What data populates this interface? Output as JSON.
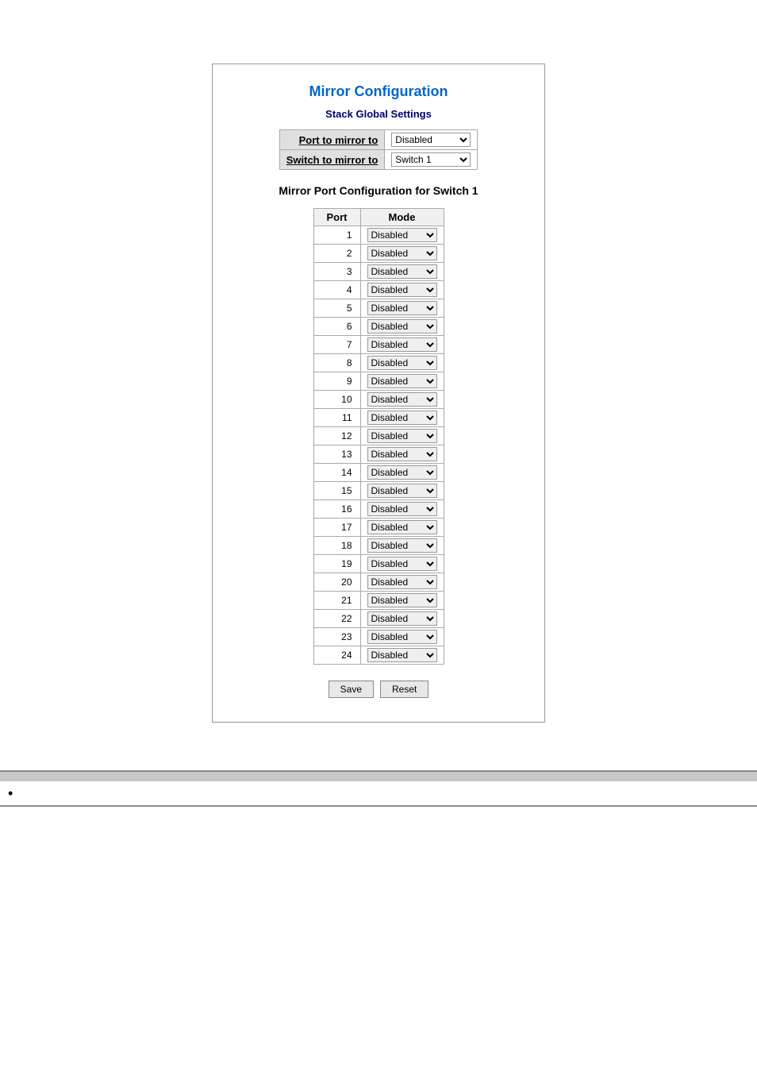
{
  "page": {
    "title": "Mirror Configuration",
    "section_title": "Stack Global Settings",
    "mirror_port_title": "Mirror Port Configuration for Switch 1",
    "global_settings": {
      "port_to_mirror_label": "Port to mirror to",
      "port_to_mirror_value": "Disabled",
      "switch_to_mirror_label": "Switch to mirror to",
      "switch_to_mirror_value": "Switch 1"
    },
    "port_table": {
      "col_port": "Port",
      "col_mode": "Mode",
      "rows": [
        {
          "port": "1",
          "mode": "Disabled"
        },
        {
          "port": "2",
          "mode": "Disabled"
        },
        {
          "port": "3",
          "mode": "Disabled"
        },
        {
          "port": "4",
          "mode": "Disabled"
        },
        {
          "port": "5",
          "mode": "Disabled"
        },
        {
          "port": "6",
          "mode": "Disabled"
        },
        {
          "port": "7",
          "mode": "Disabled"
        },
        {
          "port": "8",
          "mode": "Disabled"
        },
        {
          "port": "9",
          "mode": "Disabled"
        },
        {
          "port": "10",
          "mode": "Disabled"
        },
        {
          "port": "11",
          "mode": "Disabled"
        },
        {
          "port": "12",
          "mode": "Disabled"
        },
        {
          "port": "13",
          "mode": "Disabled"
        },
        {
          "port": "14",
          "mode": "Disabled"
        },
        {
          "port": "15",
          "mode": "Disabled"
        },
        {
          "port": "16",
          "mode": "Disabled"
        },
        {
          "port": "17",
          "mode": "Disabled"
        },
        {
          "port": "18",
          "mode": "Disabled"
        },
        {
          "port": "19",
          "mode": "Disabled"
        },
        {
          "port": "20",
          "mode": "Disabled"
        },
        {
          "port": "21",
          "mode": "Disabled"
        },
        {
          "port": "22",
          "mode": "Disabled"
        },
        {
          "port": "23",
          "mode": "Disabled"
        },
        {
          "port": "24",
          "mode": "Disabled"
        }
      ]
    },
    "buttons": {
      "save": "Save",
      "reset": "Reset"
    },
    "bottom_table": {
      "col1_header": "",
      "col2_header": "",
      "row1_col1": "•",
      "row1_col2": ""
    }
  }
}
